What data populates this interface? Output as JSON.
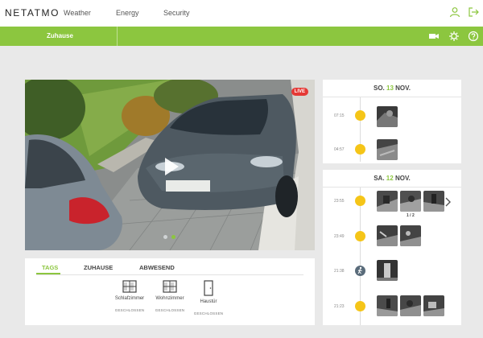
{
  "app": {
    "brand": "NETATMO",
    "nav": [
      "Weather",
      "Energy",
      "Security"
    ]
  },
  "home": {
    "name": "Zuhause"
  },
  "camera": {
    "live_label": "LIVE",
    "active_slide": 2,
    "slides": 2
  },
  "tabs": {
    "items": [
      "TAGS",
      "ZUHAUSE",
      "ABWESEND"
    ],
    "active": "TAGS",
    "sensors": [
      {
        "name": "Schlafzimmer",
        "status": "GESCHLOSSEN",
        "icon": "window-icon"
      },
      {
        "name": "Wohnzimmer",
        "status": "GESCHLOSSEN",
        "icon": "window-icon"
      },
      {
        "name": "Haustür",
        "status": "GESCHLOSSEN",
        "icon": "door-icon"
      }
    ]
  },
  "timeline": {
    "days": [
      {
        "weekday": "SO.",
        "day": "13",
        "month": "NOV.",
        "events": [
          {
            "time": "07:15",
            "type": "face",
            "thumbs": 1
          },
          {
            "time": "04:57",
            "type": "face",
            "thumbs": 1
          }
        ]
      },
      {
        "weekday": "SA.",
        "day": "12",
        "month": "NOV.",
        "events": [
          {
            "time": "23:55",
            "type": "face",
            "thumbs": 3,
            "pager": "1 / 2"
          },
          {
            "time": "23:49",
            "type": "face",
            "thumbs": 2
          },
          {
            "time": "21:38",
            "type": "walk",
            "thumbs": 1
          },
          {
            "time": "21:23",
            "type": "face",
            "thumbs": 3
          }
        ]
      }
    ]
  },
  "colors": {
    "accent": "#8cc63f",
    "live": "#e53935",
    "face_event": "#f5c518",
    "motion_event": "#596b7a",
    "background": "#e9e9e9"
  },
  "icons": {
    "user": "user-icon",
    "logout": "logout-icon",
    "camera": "video-camera-icon",
    "settings": "gear-icon",
    "help": "help-icon",
    "play": "play-icon",
    "next": "chevron-right-icon"
  }
}
